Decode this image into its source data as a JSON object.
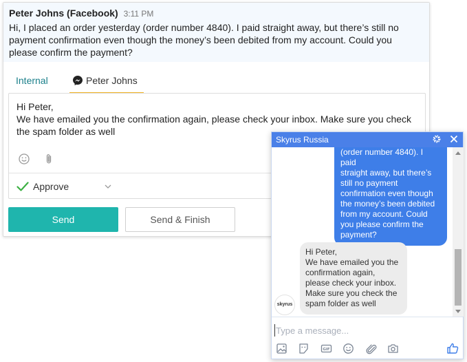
{
  "conversation": {
    "sender": "Peter Johns (Facebook)",
    "time": "3:11 PM",
    "message": "Hi, I placed an order yesterday (order number 4840). I paid straight away, but there’s still no payment confirmation even though the money’s been debited from my account. Could you please confirm the payment?"
  },
  "tabs": {
    "internal": "Internal",
    "facebook": "Peter Johns"
  },
  "composer": {
    "line1": "Hi Peter,",
    "line2": "We have emailed you the confirmation again, please check your inbox. Make sure you check the spam folder as well",
    "status": "Approve"
  },
  "buttons": {
    "send": "Send",
    "send_finish": "Send & Finish"
  },
  "widget": {
    "title": "Skyrus Russia",
    "outgoing": "(order number 4840). I paid\nstraight away, but there’s\nstill no payment\nconfirmation even though\nthe money’s been debited\nfrom my account. Could\nyou please confirm the\npayment?",
    "incoming": "Hi Peter,\nWe have emailed you the\nconfirmation again,\nplease check your inbox.\nMake sure you check the\nspam folder as well",
    "avatar": "skyrus",
    "input_placeholder": "Type a message...",
    "accent": "#4a80e8"
  },
  "colors": {
    "send_button": "#1fb5ad",
    "tab_active_underline": "#f0b323",
    "internal_tab": "#1a7f8a"
  }
}
